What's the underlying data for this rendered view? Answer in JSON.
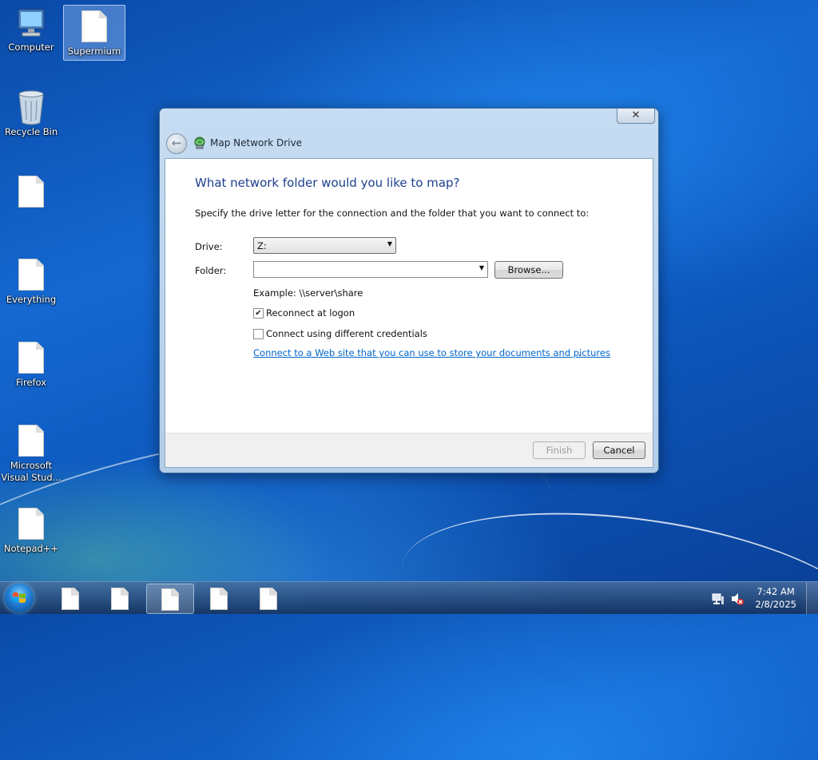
{
  "desktop": {
    "icons": [
      {
        "label": "Computer",
        "icon": "computer-icon",
        "selected": false
      },
      {
        "label": "Supermium",
        "icon": "file-icon",
        "selected": true
      },
      {
        "label": "Recycle Bin",
        "icon": "recycle-bin-icon",
        "selected": false
      },
      {
        "label": "",
        "icon": "file-icon",
        "selected": false
      },
      {
        "label": "Everything",
        "icon": "file-icon",
        "selected": false
      },
      {
        "label": "Firefox",
        "icon": "file-icon",
        "selected": false
      },
      {
        "label": "Microsoft Visual Stud...",
        "icon": "file-icon",
        "selected": false
      },
      {
        "label": "Notepad++",
        "icon": "file-icon",
        "selected": false
      }
    ]
  },
  "dialog": {
    "title": "Map Network Drive",
    "close_label": "✕",
    "heading": "What network folder would you like to map?",
    "instruction": "Specify the drive letter for the connection and the folder that you want to connect to:",
    "drive_label": "Drive:",
    "drive_value": "Z:",
    "folder_label": "Folder:",
    "folder_value": "",
    "browse_label": "Browse...",
    "example": "Example: \\\\server\\share",
    "reconnect_label": "Reconnect at logon",
    "reconnect_checked": true,
    "credentials_label": "Connect using different credentials",
    "credentials_checked": false,
    "web_link": "Connect to a Web site that you can use to store your documents and pictures",
    "web_link_suffix": ".",
    "finish_label": "Finish",
    "finish_enabled": false,
    "cancel_label": "Cancel"
  },
  "taskbar": {
    "buttons": [
      {
        "icon": "file-icon",
        "active": false
      },
      {
        "icon": "file-icon",
        "active": false
      },
      {
        "icon": "file-icon",
        "active": true
      },
      {
        "icon": "file-icon",
        "active": false
      },
      {
        "icon": "file-icon",
        "active": false
      }
    ],
    "tray": [
      "network-icon",
      "volume-muted-icon"
    ],
    "time": "7:42 AM",
    "date": "2/8/2025"
  },
  "colors": {
    "heading": "#1c3f8e",
    "link": "#0066cc",
    "desktop_blue": "#1468d0"
  }
}
